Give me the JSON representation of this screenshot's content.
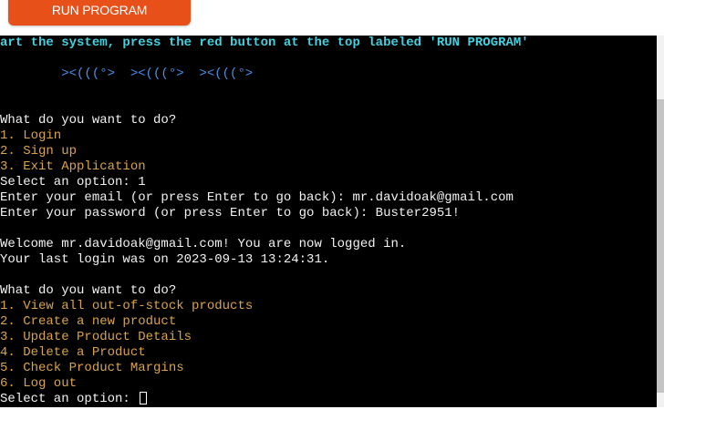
{
  "run_button": {
    "label": "RUN PROGRAM"
  },
  "terminal": {
    "lines": [
      "art the system, press the red button at the top labeled 'RUN PROGRAM'",
      "        ><(((°>  ><(((°>  ><(((°>",
      "What do you want to do?",
      "1. Login",
      "2. Sign up",
      "3. Exit Application",
      "Select an option: 1",
      "Enter your email (or press Enter to go back): mr.davidoak@gmail.com",
      "Enter your password (or press Enter to go back): Buster2951!",
      "Welcome mr.davidoak@gmail.com! You are now logged in.",
      "Your last login was on 2023-09-13 13:24:31.",
      "What do you want to do?",
      "1. View all out-of-stock products",
      "2. Create a new product",
      "3. Update Product Details",
      "4. Delete a Product",
      "5. Check Product Margins",
      "6. Log out",
      "Select an option: "
    ]
  },
  "colors": {
    "button": "#e8501a",
    "banner": "#43d1e0",
    "fish": "#4b8fe8",
    "menu_item": "#d9a34a",
    "text": "#f2f2f2",
    "terminal_bg": "#000000"
  }
}
